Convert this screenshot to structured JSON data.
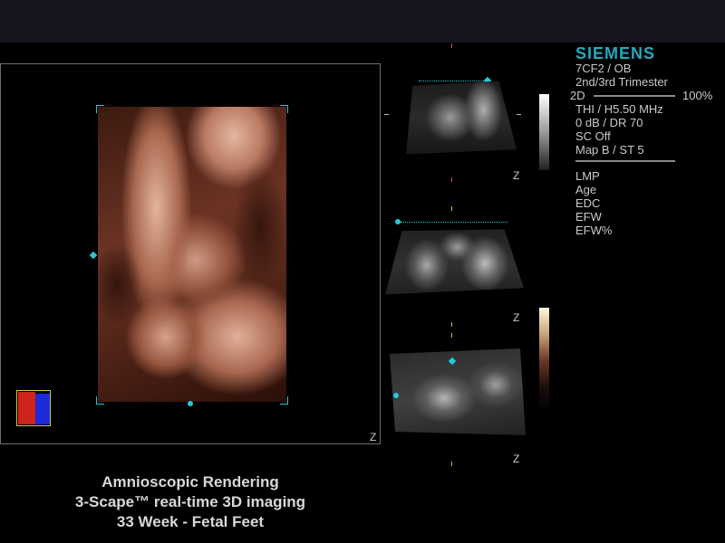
{
  "brand": "SIEMENS",
  "info_top": [
    "7CF2 / OB",
    "2nd/3rd Trimester"
  ],
  "gain": {
    "mode": "2D",
    "percent": "100%",
    "level": 1.0
  },
  "info_mid": [
    "THI / H5.50 MHz",
    "0 dB / DR 70",
    "SC Off",
    "Map B / ST 5"
  ],
  "info_patient": [
    "LMP",
    "Age",
    "EDC",
    "EFW",
    "EFW%"
  ],
  "z_label": "Z",
  "caption": [
    "Amnioscopic Rendering",
    "3-Scape™ real-time 3D imaging",
    "33 Week -  Fetal Feet"
  ],
  "colors": {
    "accent": "#24c9d6",
    "brand": "#26a9bf",
    "text": "#c9c9cf",
    "background": "#000000"
  }
}
